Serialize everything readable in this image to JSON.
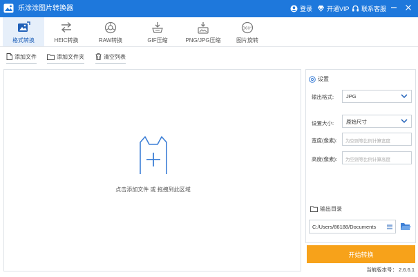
{
  "window": {
    "title": "乐涂涂图片转换器",
    "login_label": "登录",
    "vip_label": "开通VIP",
    "support_label": "联系客服"
  },
  "tabs": [
    {
      "label": "格式转换",
      "icon": "image-convert-icon",
      "active": true
    },
    {
      "label": "HEIC转换",
      "icon": "swap-arrows-icon",
      "active": false
    },
    {
      "label": "RAW转换",
      "icon": "raw-camera-icon",
      "active": false
    },
    {
      "label": "GIF压缩",
      "icon": "gif-compress-icon",
      "active": false
    },
    {
      "label": "PNG/JPG压缩",
      "icon": "image-compress-icon",
      "active": false
    },
    {
      "label": "图片旋转",
      "icon": "rotate-360-icon",
      "active": false
    }
  ],
  "toolbar": {
    "add_file": "添加文件",
    "add_folder": "添加文件夹",
    "clear_list": "清空列表"
  },
  "drop_area": {
    "hint": "点击添加文件 或 拖拽到此区域"
  },
  "settings": {
    "title": "设置",
    "format_label": "输出格式:",
    "format_value": "JPG",
    "size_label": "设置大小:",
    "size_value": "原始尺寸",
    "width_label": "宽度(像素):",
    "width_placeholder": "为空则等比例计算宽度",
    "height_label": "高度(像素):",
    "height_placeholder": "为空则等比例计算高度",
    "output_label": "输出目录",
    "output_path": "C:/Users/86188/Documents"
  },
  "start_button": "开始转换",
  "version": {
    "label": "当前版本号：",
    "number": "2.6.6.1"
  },
  "colors": {
    "titlebar": "#1e78dc",
    "accent": "#1e5fb8",
    "start": "#f7a21a"
  }
}
